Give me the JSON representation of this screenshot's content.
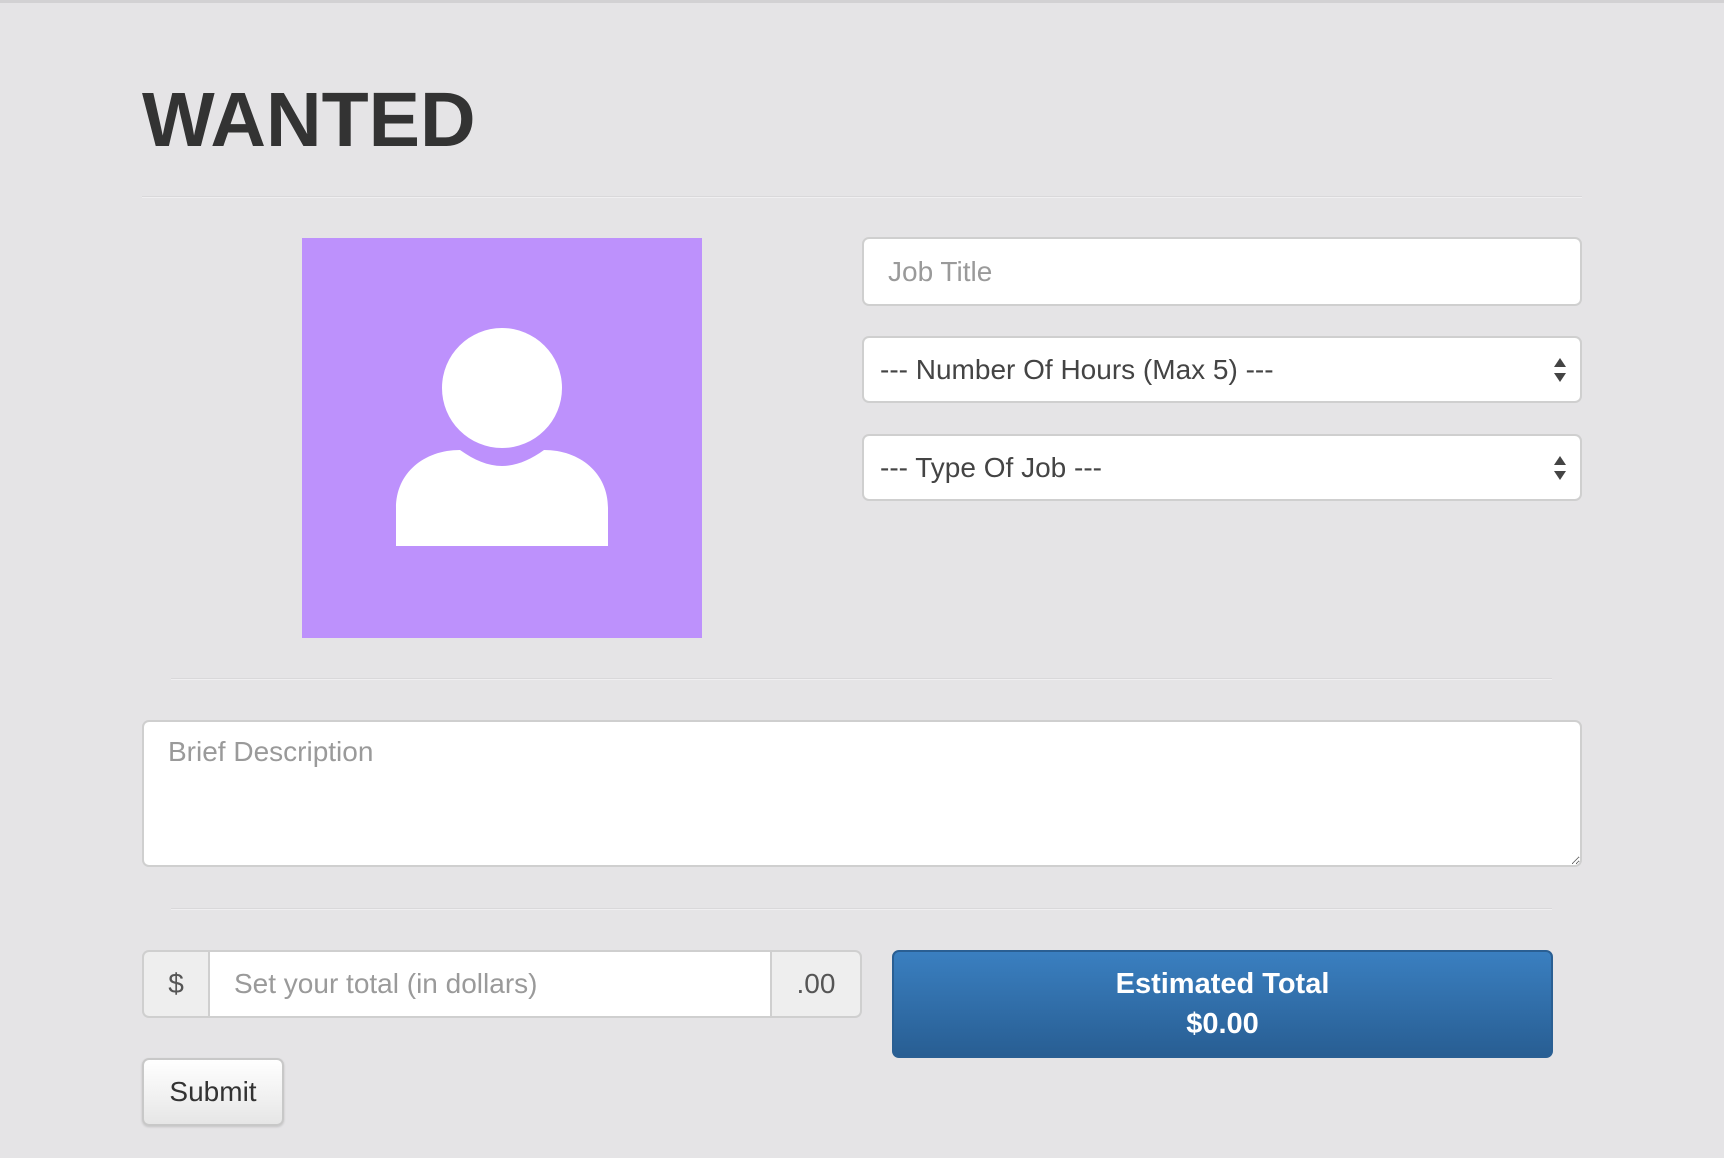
{
  "page": {
    "title": "WANTED"
  },
  "form": {
    "avatar_icon": "user-placeholder-icon",
    "avatar_color": "#bd91fc",
    "job_title_placeholder": "Job Title",
    "hours_select_value": "--- Number Of Hours (Max 5) ---",
    "type_select_value": "--- Type Of Job ---",
    "description_placeholder": "Brief Description",
    "currency_symbol": "$",
    "amount_placeholder": "Set your total (in dollars)",
    "cents_suffix": ".00",
    "estimate_label": "Estimated Total",
    "estimate_value": "$0.00",
    "submit_label": "Submit"
  },
  "colors": {
    "background": "#e5e4e6",
    "primary_button": "#3070ab"
  }
}
